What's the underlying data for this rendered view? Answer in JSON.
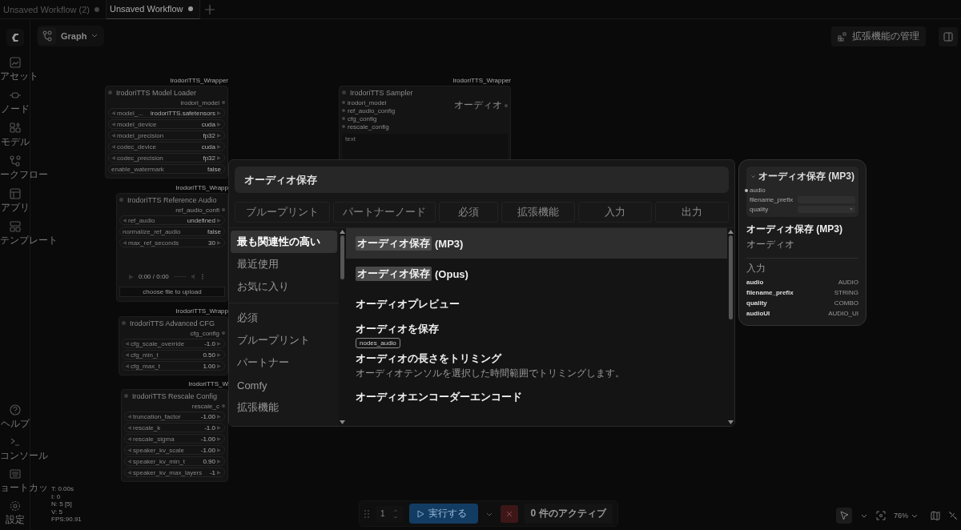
{
  "tabs": [
    {
      "label": "Unsaved Workflow (2)",
      "selected": false,
      "unsaved": true
    },
    {
      "label": "Unsaved Workflow",
      "selected": true,
      "unsaved": true
    }
  ],
  "sidebar": {
    "top": [
      {
        "label": "アセット",
        "kind": "assets"
      },
      {
        "label": "ノード",
        "kind": "nodes"
      },
      {
        "label": "モデル",
        "kind": "models"
      },
      {
        "label": "ークフロー",
        "kind": "workflows"
      },
      {
        "label": "アプリ",
        "kind": "apps"
      },
      {
        "label": "テンプレート",
        "kind": "templates"
      }
    ],
    "bottom": [
      {
        "label": "ヘルプ",
        "kind": "help"
      },
      {
        "label": "コンソール",
        "kind": "console"
      },
      {
        "label": "ョートカッ",
        "kind": "shortcuts"
      },
      {
        "label": "設定",
        "kind": "settings"
      }
    ]
  },
  "view_menu": {
    "label": "Graph"
  },
  "top_actions": {
    "extensions": "拡張機能の管理"
  },
  "stats": [
    "T: 0.00s",
    "I: 0",
    "N: 5 [5]",
    "V: 5",
    "FPS:90.91"
  ],
  "nodes": [
    {
      "wrapper": "IrodoriTTS_Wrapper",
      "title": "IrodoriTTS Model Loader",
      "outputs": [
        "irodori_model"
      ],
      "widgets": [
        {
          "name": "model_...",
          "value": "irodoriTTS.safetensors",
          "kind": "combo"
        },
        {
          "name": "model_device",
          "value": "cuda",
          "kind": "combo"
        },
        {
          "name": "model_precision",
          "value": "fp32",
          "kind": "combo"
        },
        {
          "name": "codec_device",
          "value": "cuda",
          "kind": "combo"
        },
        {
          "name": "codec_precision",
          "value": "fp32",
          "kind": "combo"
        },
        {
          "name": "enable_watermark",
          "value": "false",
          "kind": "toggle"
        }
      ]
    },
    {
      "wrapper": "IrodoriTTS_Wrapper",
      "title": "IrodoriTTS Sampler",
      "inputs": [
        "irodori_model",
        "ref_audio_config",
        "cfg_config",
        "rescale_config"
      ],
      "outputs": [
        "オーディオ"
      ],
      "text_placeholder": "text"
    },
    {
      "wrapper": "IrodoriTTS_Wrapp",
      "title": "IrodoriTTS Reference Audio",
      "outputs": [
        "ref_audio_confi"
      ],
      "widgets": [
        {
          "name": "ref_audio",
          "value": "undefined",
          "kind": "combo"
        },
        {
          "name": "normalize_ref_audio",
          "value": "false",
          "kind": "toggle"
        },
        {
          "name": "max_ref_seconds",
          "value": "30",
          "kind": "number"
        }
      ],
      "player": "0:00 / 0:00",
      "upload": "choose file to upload"
    },
    {
      "wrapper": "IrodoriTTS_Wrapp",
      "title": "IrodoriTTS Advanced CFG",
      "outputs": [
        "cfg_config"
      ],
      "widgets": [
        {
          "name": "cfg_scale_override",
          "value": "-1.0",
          "kind": "number"
        },
        {
          "name": "cfg_min_t",
          "value": "0.50",
          "kind": "number"
        },
        {
          "name": "cfg_max_t",
          "value": "1.00",
          "kind": "number"
        }
      ]
    },
    {
      "wrapper": "IrodoriTTS_W",
      "title": "IrodoriTTS Rescale Config",
      "outputs": [
        "rescale_c"
      ],
      "widgets": [
        {
          "name": "truncation_factor",
          "value": "-1.00",
          "kind": "number"
        },
        {
          "name": "rescale_k",
          "value": "-1.0",
          "kind": "number"
        },
        {
          "name": "rescale_sigma",
          "value": "-1.00",
          "kind": "number"
        },
        {
          "name": "speaker_kv_scale",
          "value": "-1.00",
          "kind": "number"
        },
        {
          "name": "speaker_kv_min_t",
          "value": "0.90",
          "kind": "number"
        },
        {
          "name": "speaker_kv_max_layers",
          "value": "-1",
          "kind": "number"
        }
      ]
    }
  ],
  "search_dialog": {
    "query": "オーディオ保存",
    "filters": [
      {
        "label": "ブループリント",
        "selected": false
      },
      {
        "label": "パートナーノード",
        "selected": false
      },
      {
        "label": "必須",
        "selected": false
      },
      {
        "label": "拡張機能",
        "selected": false
      },
      {
        "label": "入力",
        "selected": false
      },
      {
        "label": "出力",
        "selected": false
      }
    ],
    "categories": [
      {
        "label": "最も関連性の高い",
        "selected": true
      },
      {
        "label": "最近使用",
        "selected": false
      },
      {
        "label": "お気に入り",
        "selected": false
      }
    ],
    "sources": [
      {
        "label": "必須",
        "selected": false
      },
      {
        "label": "ブループリント",
        "selected": false
      },
      {
        "label": "パートナー",
        "selected": false
      },
      {
        "label": "Comfy",
        "selected": false
      },
      {
        "label": "拡張機能",
        "selected": false
      }
    ],
    "results": [
      {
        "highlight": "オーディオ保存",
        "title": "(MP3)",
        "selected": true
      },
      {
        "highlight": "オーディオ保存",
        "title": "(Opus)",
        "selected": false
      },
      {
        "title": "オーディオプレビュー",
        "selected": false
      },
      {
        "title": "オーディオを保存",
        "badge": "nodes_audio",
        "selected": false
      },
      {
        "title": "オーディオの長さをトリミング",
        "description": "オーディオテンソルを選択した時間範囲でトリミングします。",
        "selected": false
      },
      {
        "title": "オーディオエンコーダーエンコード",
        "selected": false
      }
    ]
  },
  "preview": {
    "node_title": "オーディオ保存 (MP3)",
    "node_inputs": [
      "audio"
    ],
    "node_widgets": [
      {
        "name": "filename_prefix",
        "kind": "text"
      },
      {
        "name": "quality",
        "kind": "combo"
      }
    ],
    "title": "オーディオ保存 (MP3)",
    "category": "オーディオ",
    "inputs_heading": "入力",
    "inputs": [
      {
        "name": "audio",
        "type": "AUDIO"
      },
      {
        "name": "filename_prefix",
        "type": "STRING"
      },
      {
        "name": "quality",
        "type": "COMBO"
      },
      {
        "name": "audioUI",
        "type": "AUDIO_UI"
      }
    ]
  },
  "queue": {
    "count": "1",
    "run": "実行する",
    "active": "0 件のアクティブ"
  },
  "canvas_tools": {
    "zoom": "76%"
  }
}
